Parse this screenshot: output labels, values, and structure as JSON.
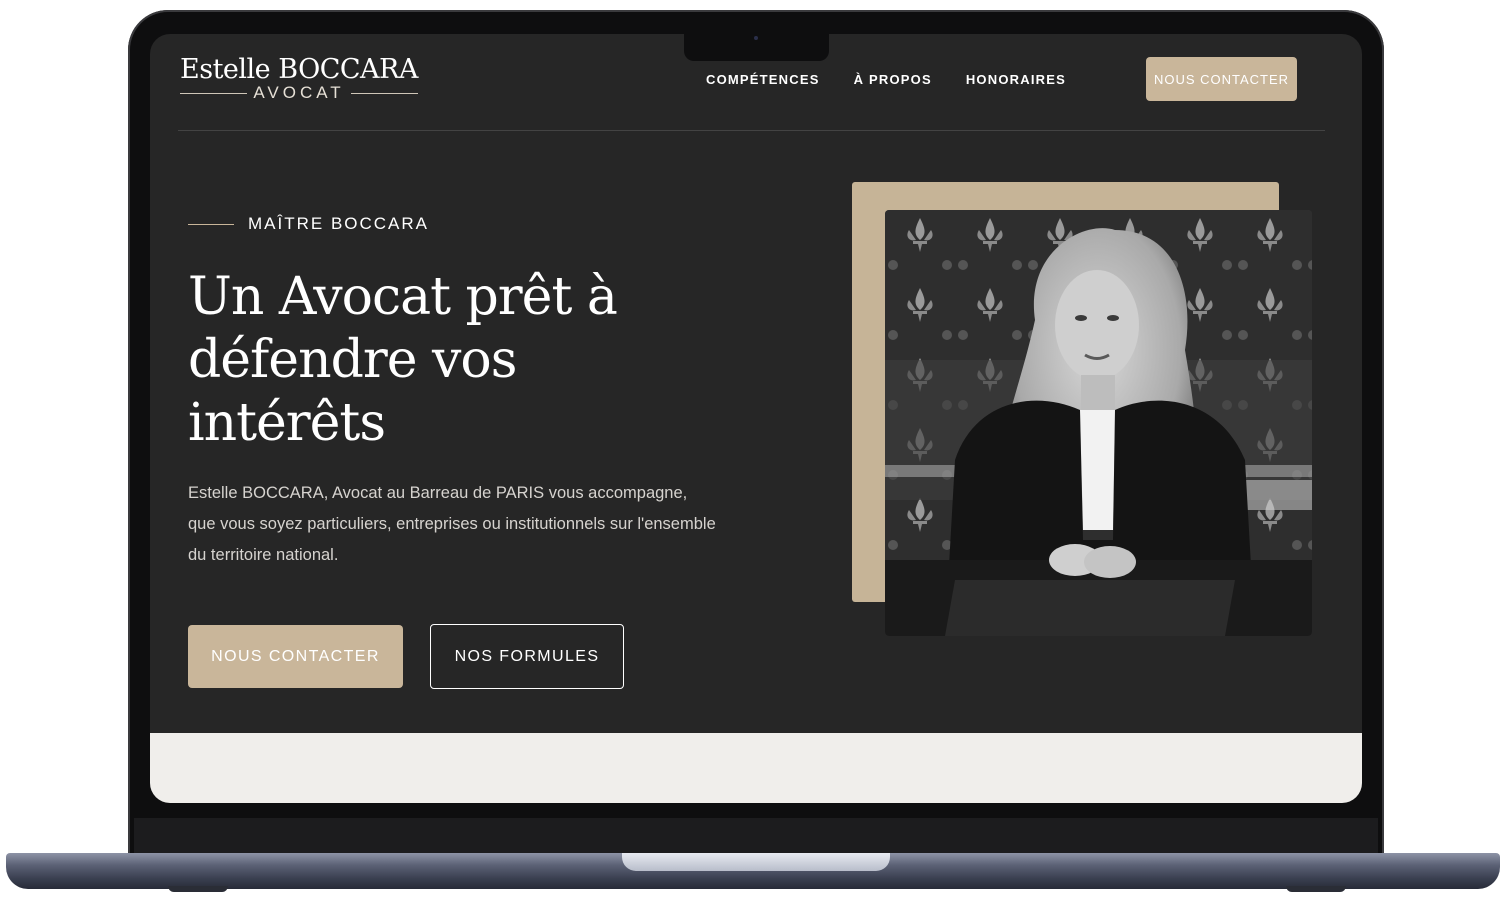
{
  "brand": {
    "name": "Estelle BOCCARA",
    "subtitle": "AVOCAT"
  },
  "nav": {
    "items": [
      {
        "label": "COMPÉTENCES"
      },
      {
        "label": "À PROPOS"
      },
      {
        "label": "HONORAIRES"
      }
    ],
    "cta_label": "NOUS CONTACTER"
  },
  "hero": {
    "eyebrow": "MAÎTRE BOCCARA",
    "title": "Un Avocat prêt à défendre vos intérêts",
    "text": "Estelle BOCCARA, Avocat au Barreau de PARIS vous accompagne, que vous soyez particuliers, entreprises ou institutionnels sur l'ensemble du territoire national.",
    "primary_button": "NOUS CONTACTER",
    "secondary_button": "NOS FORMULES"
  },
  "colors": {
    "background": "#262626",
    "accent": "#c9b69a",
    "light_section": "#f0eeeb"
  },
  "photo": {
    "icon": "portrait-photo"
  }
}
